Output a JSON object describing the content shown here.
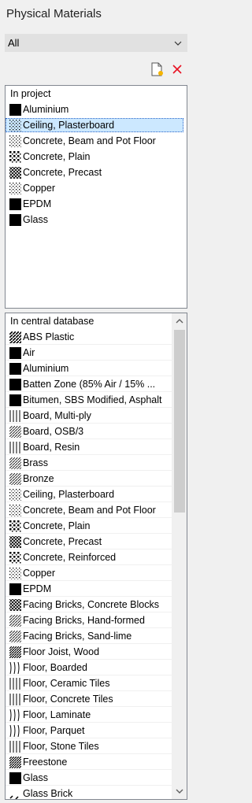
{
  "header": {
    "title": "Physical Materials"
  },
  "filter": {
    "value": "All"
  },
  "toolbar": {
    "new_icon": "new-material-icon",
    "delete_icon": "delete-icon",
    "accent": "#e81123"
  },
  "project_list": {
    "header": "In project",
    "items": [
      {
        "label": "Aluminium",
        "pattern": "solid"
      },
      {
        "label": "Ceiling, Plasterboard",
        "pattern": "dots",
        "selected": true
      },
      {
        "label": "Concrete, Beam and Pot Floor",
        "pattern": "dots"
      },
      {
        "label": "Concrete, Plain",
        "pattern": "blob"
      },
      {
        "label": "Concrete, Precast",
        "pattern": "cross"
      },
      {
        "label": "Copper",
        "pattern": "dots"
      },
      {
        "label": "EPDM",
        "pattern": "solid"
      },
      {
        "label": "Glass",
        "pattern": "solid"
      }
    ]
  },
  "database_list": {
    "header": "In central database",
    "items": [
      {
        "label": "ABS Plastic",
        "pattern": "diag"
      },
      {
        "label": "Air",
        "pattern": "solid"
      },
      {
        "label": "Aluminium",
        "pattern": "solid"
      },
      {
        "label": "Batten Zone (85% Air / 15% ...",
        "pattern": "solid"
      },
      {
        "label": "Bitumen, SBS Modified, Asphalt",
        "pattern": "solid"
      },
      {
        "label": "Board, Multi-ply",
        "pattern": "vert"
      },
      {
        "label": "Board, OSB/3",
        "pattern": "diagthin"
      },
      {
        "label": "Board, Resin",
        "pattern": "vert"
      },
      {
        "label": "Brass",
        "pattern": "diagthin"
      },
      {
        "label": "Bronze",
        "pattern": "diagthin"
      },
      {
        "label": "Ceiling, Plasterboard",
        "pattern": "dots"
      },
      {
        "label": "Concrete, Beam and Pot Floor",
        "pattern": "dots"
      },
      {
        "label": "Concrete, Plain",
        "pattern": "blob"
      },
      {
        "label": "Concrete, Precast",
        "pattern": "cross"
      },
      {
        "label": "Concrete, Reinforced",
        "pattern": "blob"
      },
      {
        "label": "Copper",
        "pattern": "dots"
      },
      {
        "label": "EPDM",
        "pattern": "solid"
      },
      {
        "label": "Facing Bricks, Concrete Blocks",
        "pattern": "cross"
      },
      {
        "label": "Facing Bricks, Hand-formed",
        "pattern": "diagthin"
      },
      {
        "label": "Facing Bricks, Sand-lime",
        "pattern": "diagthin"
      },
      {
        "label": "Floor Joist, Wood",
        "pattern": "hatch"
      },
      {
        "label": "Floor, Boarded",
        "pattern": "wave"
      },
      {
        "label": "Floor, Ceramic Tiles",
        "pattern": "vert"
      },
      {
        "label": "Floor, Concrete Tiles",
        "pattern": "vert"
      },
      {
        "label": "Floor, Laminate",
        "pattern": "wave"
      },
      {
        "label": "Floor, Parquet",
        "pattern": "wave"
      },
      {
        "label": "Floor, Stone Tiles",
        "pattern": "vert"
      },
      {
        "label": "Freestone",
        "pattern": "hatch"
      },
      {
        "label": "Glass",
        "pattern": "solid"
      },
      {
        "label": "Glass Brick",
        "pattern": "glassbrick"
      }
    ]
  }
}
